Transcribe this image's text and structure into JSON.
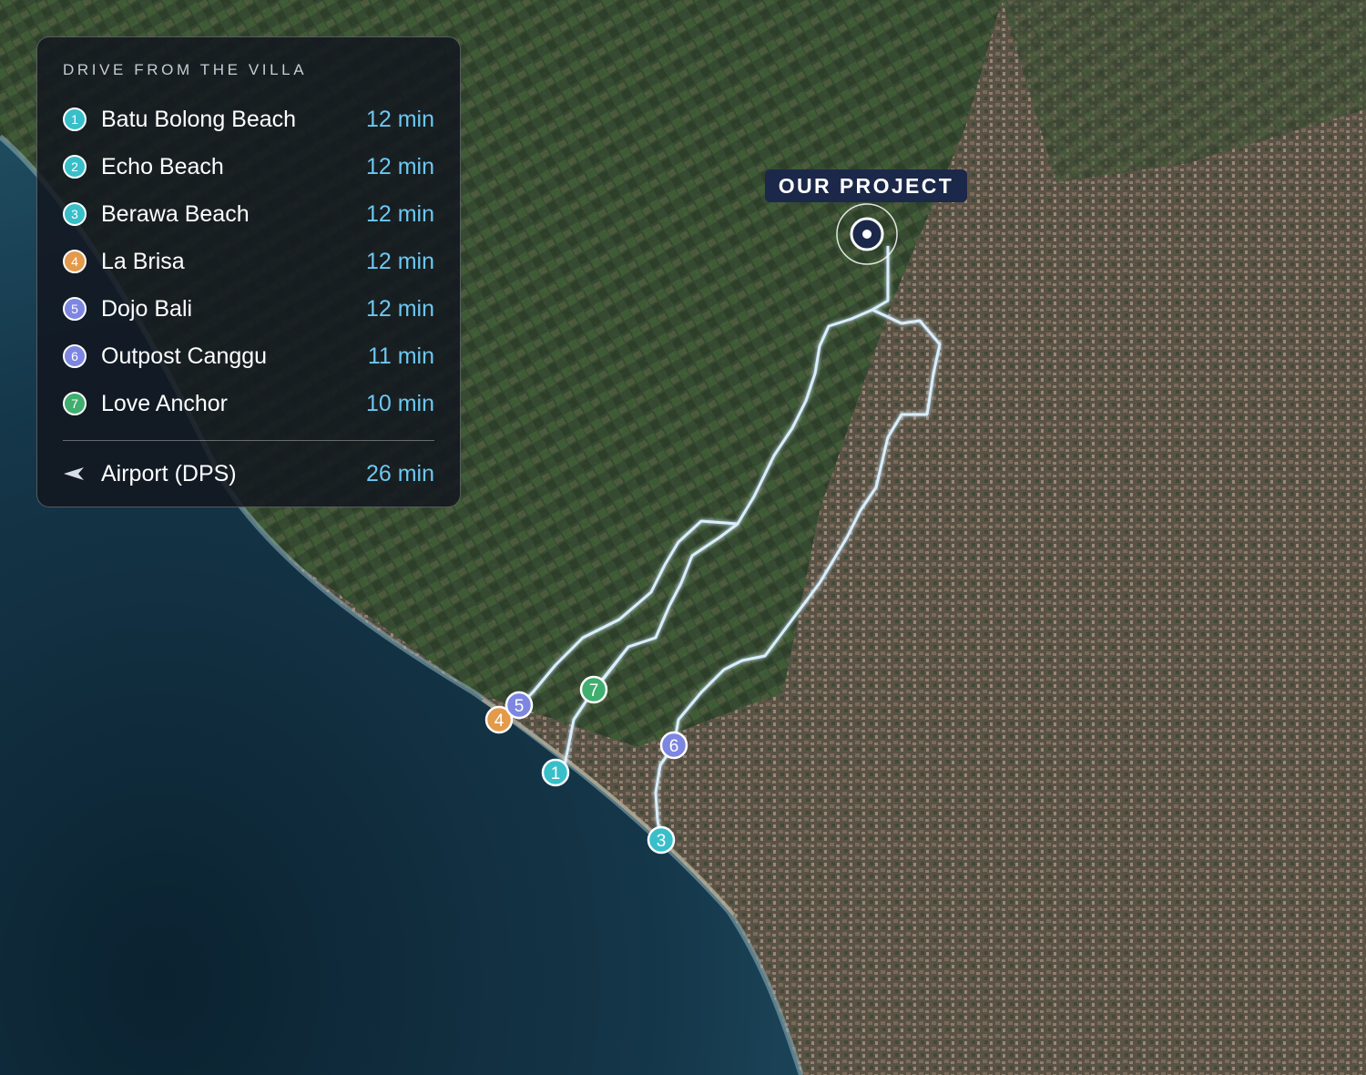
{
  "legend": {
    "title": "DRIVE FROM THE VILLA",
    "items": [
      {
        "num": "1",
        "name": "Batu Bolong Beach",
        "time": "12 min",
        "color": "#38bfc9"
      },
      {
        "num": "2",
        "name": "Echo Beach",
        "time": "12 min",
        "color": "#38bfc9"
      },
      {
        "num": "3",
        "name": "Berawa Beach",
        "time": "12 min",
        "color": "#38bfc9"
      },
      {
        "num": "4",
        "name": "La Brisa",
        "time": "12 min",
        "color": "#e39a4b"
      },
      {
        "num": "5",
        "name": "Dojo Bali",
        "time": "12 min",
        "color": "#7d86e0"
      },
      {
        "num": "6",
        "name": "Outpost Canggu",
        "time": "11 min",
        "color": "#7d86e0"
      },
      {
        "num": "7",
        "name": "Love Anchor",
        "time": "10 min",
        "color": "#3fae6e"
      }
    ],
    "airport": {
      "name": "Airport (DPS)",
      "time": "26 min",
      "icon": "plane-arrow-icon"
    }
  },
  "project": {
    "label": "OUR PROJECT"
  },
  "colors": {
    "route": "#d9efff",
    "time": "#6cc8f2",
    "label_bg": "#1c2849"
  }
}
